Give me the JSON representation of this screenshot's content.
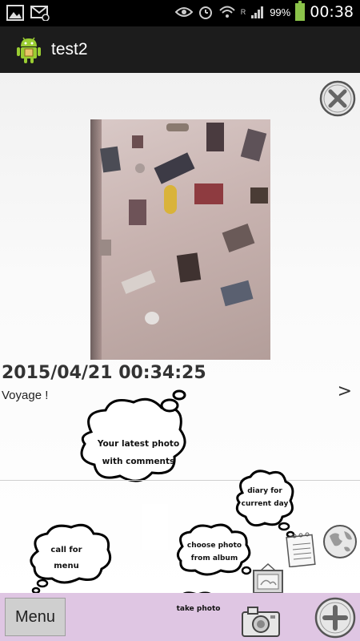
{
  "status_bar": {
    "battery_percent": "99%",
    "time": "00:38",
    "network_label": "R"
  },
  "app": {
    "title": "test2"
  },
  "entry": {
    "date": "2015/04/21 00:34:25",
    "comment": "Voyage !",
    "next_arrow": ">"
  },
  "tips": {
    "latest_photo_line1": "Your latest photo",
    "latest_photo_line2": "with comments",
    "diary_line1": "diary for",
    "diary_line2": "current day",
    "choose_photo_line1": "choose photo",
    "choose_photo_line2": "from album",
    "call_menu_line1": "call for",
    "call_menu_line2": "menu",
    "take_photo": "take photo"
  },
  "bottom_bar": {
    "menu_label": "Menu"
  },
  "colors": {
    "bottom_bar": "#dfc6e3",
    "action_bar": "#1c1c1c",
    "battery": "#8bc34a"
  }
}
